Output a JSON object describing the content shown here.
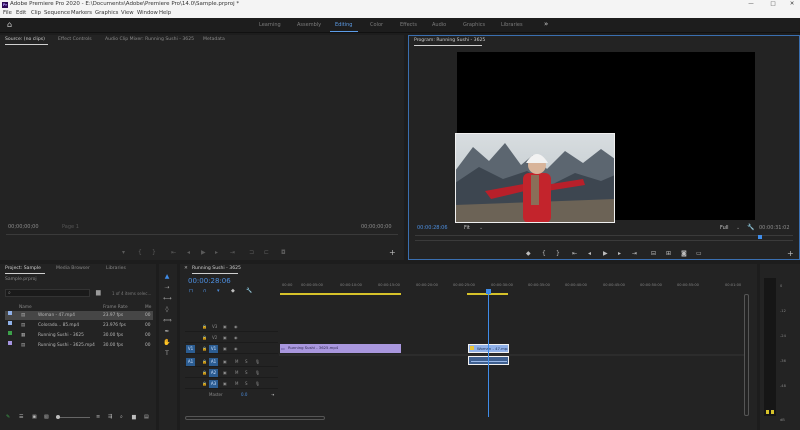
{
  "titlebar": {
    "logo": "Pr",
    "title": "Adobe Premiere Pro 2020 - E:\\Documents\\Adobe\\Premiere Pro\\14.0\\Sample.prproj *",
    "minimize": "—",
    "maximize": "□",
    "close": "✕"
  },
  "menu": [
    "File",
    "Edit",
    "Clip",
    "Sequence",
    "Markers",
    "Graphics",
    "View",
    "Window",
    "Help"
  ],
  "workspaces": {
    "items": [
      "Learning",
      "Assembly",
      "Editing",
      "Color",
      "Effects",
      "Audio",
      "Graphics",
      "Libraries"
    ],
    "active": "Editing",
    "more": "»"
  },
  "source_panel": {
    "tabs": [
      "Source: (no clips)",
      "Effect Controls",
      "Audio Clip Mixer: Running Sushi - 3625",
      "Metadata"
    ],
    "timecode_left": "00;00;00;00",
    "fit": "Page 1",
    "timecode_right": "00;00;00;00"
  },
  "program_panel": {
    "tab": "Program: Running Sushi - 3625",
    "timecode_current": "00:00:28:06",
    "fit": "Fit",
    "quality": "Full",
    "timecode_duration": "00:00:31:02"
  },
  "project_panel": {
    "tabs": [
      "Project: Sample",
      "Media Browser",
      "Libraries"
    ],
    "file": "Sample.prproj",
    "count": "1 of 4 items selec...",
    "columns": [
      "Name",
      "Frame Rate",
      "Me"
    ],
    "rows": [
      {
        "name": "Woman - 47.mp4",
        "rate": "23.97 fps",
        "me": "00",
        "color": "#8fb0e8"
      },
      {
        "name": "Colorado... 85.mp4",
        "rate": "23.976 fps",
        "me": "00",
        "color": "#8fb0e8"
      },
      {
        "name": "Running Sushi - 3625",
        "rate": "30.00 fps",
        "me": "00",
        "color": "#3ca04a"
      },
      {
        "name": "Running Sushi - 3625.mp4",
        "rate": "30.00 fps",
        "me": "00",
        "color": "#a494e0"
      }
    ]
  },
  "timeline": {
    "tab": "Running Sushi - 3625",
    "timecode": "00:00:28:06",
    "ruler": [
      "00:00",
      "00:00:05:00",
      "00:00:10:00",
      "00:00:15:00",
      "00:00:20:00",
      "00:00:25:00",
      "00:00:30:00",
      "00:00:35:00",
      "00:00:40:00",
      "00:00:45:00",
      "00:00:50:00",
      "00:00:55:00",
      "00:01:00"
    ],
    "video_tracks": [
      "V3",
      "V2",
      "V1"
    ],
    "audio_tracks": [
      "A1",
      "A2",
      "A3"
    ],
    "master_label": "Master",
    "master_value": "0.0",
    "clip_v1": "Running Sushi - 3625.mp4",
    "clip_v1b": "Woman - 47.mp4"
  },
  "meter": {
    "labels": [
      "0",
      "-12",
      "-24",
      "-36",
      "-48",
      "dB"
    ]
  }
}
